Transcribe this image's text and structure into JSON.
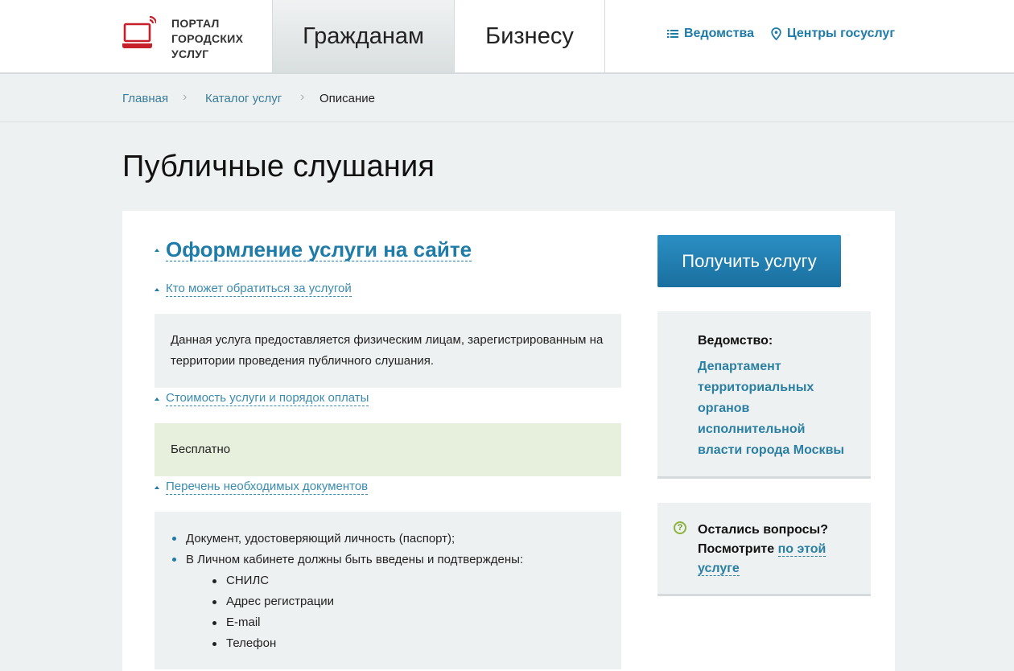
{
  "header": {
    "logo_lines": [
      "ПОРТАЛ",
      "ГОРОДСКИХ",
      "УСЛУГ"
    ],
    "tabs": [
      {
        "label": "Гражданам",
        "active": true
      },
      {
        "label": "Бизнесу",
        "active": false
      }
    ],
    "links": [
      {
        "label": "Ведомства",
        "icon": "list-icon"
      },
      {
        "label": "Центры госуслуг",
        "icon": "location-pin-icon"
      }
    ]
  },
  "breadcrumbs": {
    "items": [
      "Главная",
      "Каталог услуг"
    ],
    "current": "Описание"
  },
  "page": {
    "title": "Публичные слушания"
  },
  "main": {
    "section_title": "Оформление услуги на сайте",
    "who": {
      "label": "Кто может обратиться за услугой",
      "text": "Данная услуга предоставляется физическим лицам, зарегистрированным на территории проведения публичного слушания."
    },
    "cost": {
      "label": "Стоимость услуги и порядок оплаты",
      "text": "Бесплатно"
    },
    "docs": {
      "label": "Перечень необходимых документов",
      "items": [
        "Документ, удостоверяющий личность (паспорт);",
        "В Личном кабинете должны быть введены и подтверждены:"
      ],
      "sub_items": [
        "СНИЛС",
        "Адрес регистрации",
        "E-mail",
        "Телефон"
      ]
    }
  },
  "sidebar": {
    "button_label": "Получить услугу",
    "agency_label": "Ведомство:",
    "agency_lines": [
      "Департамент",
      "территориальных",
      "органов",
      "исполнительной",
      "власти города Москвы"
    ],
    "help_line1": "Остались вопросы?",
    "help_line2_prefix": "Посмотрите",
    "help_link_part1": "по этой",
    "help_link_part2": "услуге"
  },
  "colors": {
    "accent": "#1f7ba8",
    "logo_red": "#c8202a",
    "free_bg": "#e7f0dd"
  }
}
